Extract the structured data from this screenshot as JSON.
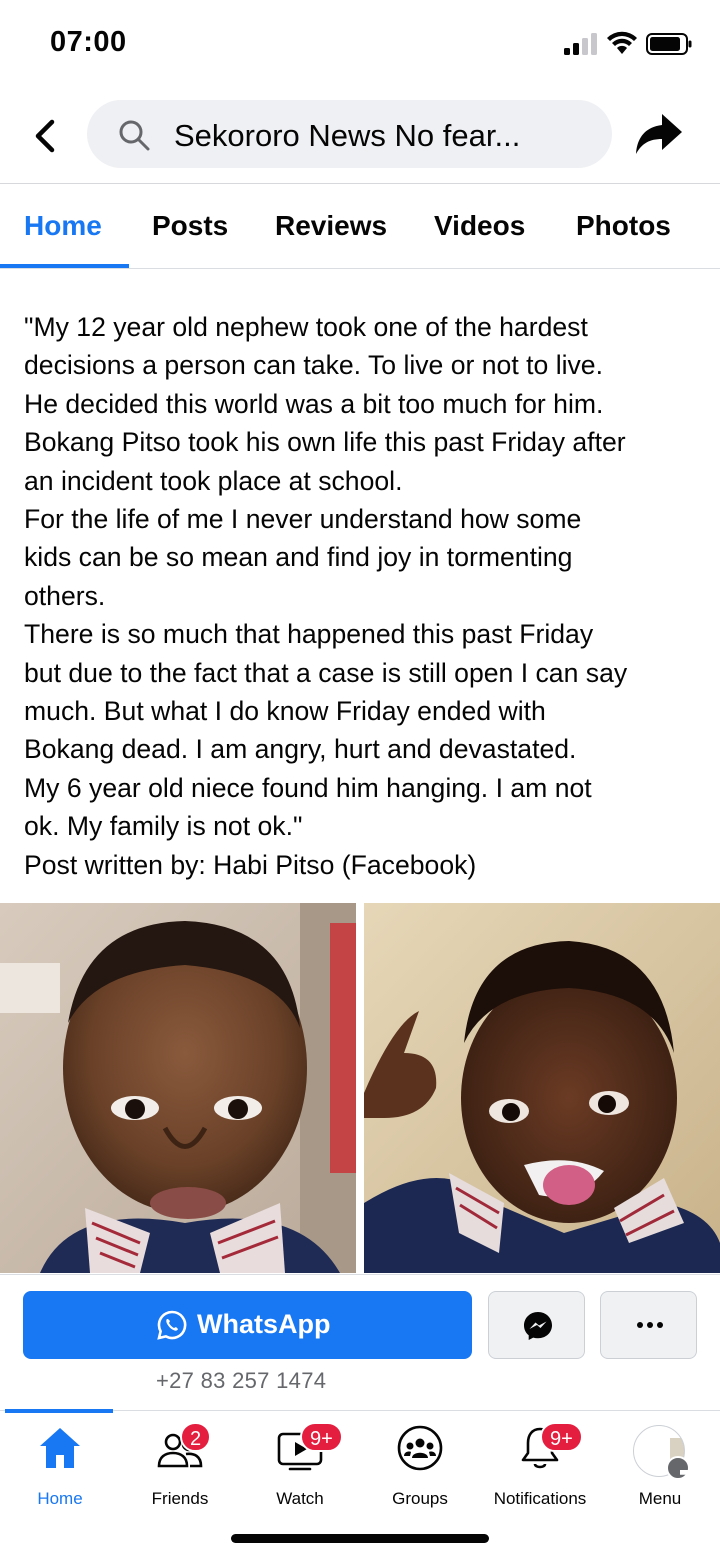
{
  "status_bar": {
    "time": "07:00"
  },
  "header": {
    "search_text": "Sekororo News No fear..."
  },
  "tabs": [
    {
      "label": "Home",
      "active": true
    },
    {
      "label": "Posts",
      "active": false
    },
    {
      "label": "Reviews",
      "active": false
    },
    {
      "label": "Videos",
      "active": false
    },
    {
      "label": "Photos",
      "active": false
    }
  ],
  "post": {
    "lines": [
      "\"My 12 year old nephew took one of the hardest",
      "decisions a person can take. To live or not to live.",
      "He decided this world was a bit too much for him.",
      "Bokang Pitso took his own life this past Friday after",
      "an incident took place at school.",
      "For the life of me I never understand how some",
      "kids can be so mean and find joy in tormenting",
      "others.",
      "There is so much that happened this past Friday",
      "but due to the fact that a case is still open I can say",
      "much. But what I do know Friday ended with",
      "Bokang dead. I am angry, hurt and devastated.",
      "My 6 year old niece found him hanging. I am not",
      "ok. My family is not ok.\"",
      "Post written by: Habi Pitso (Facebook)"
    ]
  },
  "actions": {
    "whatsapp_label": "WhatsApp",
    "phone_number": "+27 83 257 1474"
  },
  "bottom_nav": {
    "home": {
      "label": "Home"
    },
    "friends": {
      "label": "Friends",
      "badge": "2"
    },
    "watch": {
      "label": "Watch",
      "badge": "9+"
    },
    "groups": {
      "label": "Groups"
    },
    "notifications": {
      "label": "Notifications",
      "badge": "9+"
    },
    "menu": {
      "label": "Menu"
    }
  },
  "colors": {
    "accent": "#1877f2",
    "badge": "#e41e3f",
    "secondary_text": "#65676b"
  },
  "icons": [
    "back-arrow-icon",
    "search-icon",
    "share-icon",
    "whatsapp-icon",
    "messenger-icon",
    "more-icon",
    "home-icon",
    "friends-icon",
    "watch-icon",
    "groups-icon",
    "notifications-icon",
    "avatar"
  ]
}
